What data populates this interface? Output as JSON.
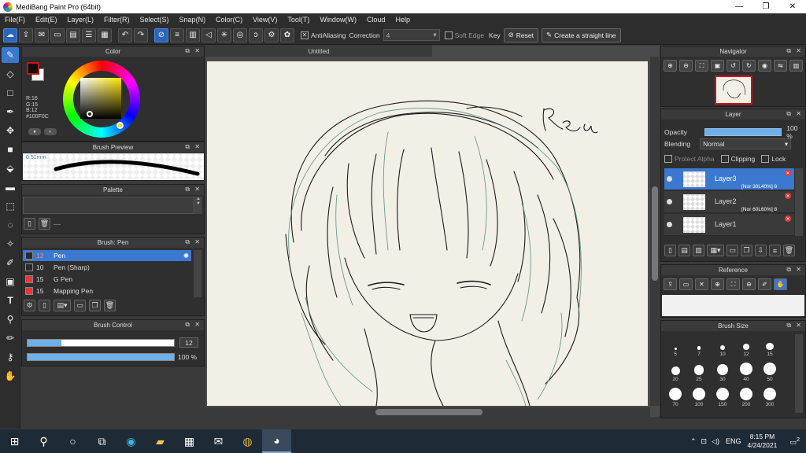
{
  "window": {
    "title": "MediBang Paint Pro (64bit)",
    "minimize": "—",
    "maximize": "❐",
    "close": "✕"
  },
  "menu": [
    "File(F)",
    "Edit(E)",
    "Layer(L)",
    "Filter(R)",
    "Select(S)",
    "Snap(N)",
    "Color(C)",
    "View(V)",
    "Tool(T)",
    "Window(W)",
    "Cloud",
    "Help"
  ],
  "toolbar": {
    "antialiasing_label": "AntiAliasing",
    "correction_label": "Correction",
    "correction_value": "4",
    "soft_edge_label": "Soft Edge",
    "key_label": "Key",
    "reset_label": "Reset",
    "straight_line_label": "Create a straight line"
  },
  "color_panel": {
    "title": "Color",
    "r": "R:16",
    "g": "G:15",
    "b": "B:12",
    "hex": "#100F0C",
    "fg_color": "#100f0c",
    "bg_color": "#ffffff"
  },
  "brush_preview": {
    "title": "Brush Preview",
    "size_text": "0.51mm"
  },
  "palette": {
    "title": "Palette",
    "footer_text": "---"
  },
  "brush_panel": {
    "title": "Brush: Pen",
    "items": [
      {
        "size": "12",
        "name": "Pen",
        "swatch": "#2a2a2a",
        "selected": true
      },
      {
        "size": "10",
        "name": "Pen (Sharp)",
        "swatch": "#2a2a2a",
        "selected": false
      },
      {
        "size": "15",
        "name": "G Pen",
        "swatch": "#e53935",
        "selected": false
      },
      {
        "size": "15",
        "name": "Mapping Pen",
        "swatch": "#e53935",
        "selected": false
      }
    ]
  },
  "brush_control": {
    "title": "Brush Control",
    "size_value": "12",
    "size_fraction": 0.23,
    "opacity_value": "100 %",
    "opacity_fraction": 1.0
  },
  "document": {
    "tab_title": "Untitled",
    "signature": "Rea"
  },
  "navigator": {
    "title": "Navigator"
  },
  "layer_panel": {
    "title": "Layer",
    "opacity_label": "Opacity",
    "opacity_value": "100 %",
    "blending_label": "Blending",
    "blending_value": "Normal",
    "protect_alpha_label": "Protect Alpha",
    "clipping_label": "Clipping",
    "lock_label": "Lock",
    "layers": [
      {
        "name": "Layer3",
        "mode": "[Nor 30L40%] 8",
        "selected": true
      },
      {
        "name": "Layer2",
        "mode": "[Nor 60L60%] 8",
        "selected": false
      },
      {
        "name": "Layer1",
        "mode": "",
        "selected": false
      }
    ]
  },
  "reference": {
    "title": "Reference"
  },
  "brush_size": {
    "title": "Brush Size",
    "sizes": [
      "5",
      "7",
      "10",
      "12",
      "15",
      "20",
      "25",
      "30",
      "40",
      "50",
      "70",
      "100",
      "150",
      "200",
      "300"
    ]
  },
  "taskbar": {
    "language": "ENG",
    "time": "8:15 PM",
    "date": "4/24/2021",
    "notification_count": "2"
  }
}
